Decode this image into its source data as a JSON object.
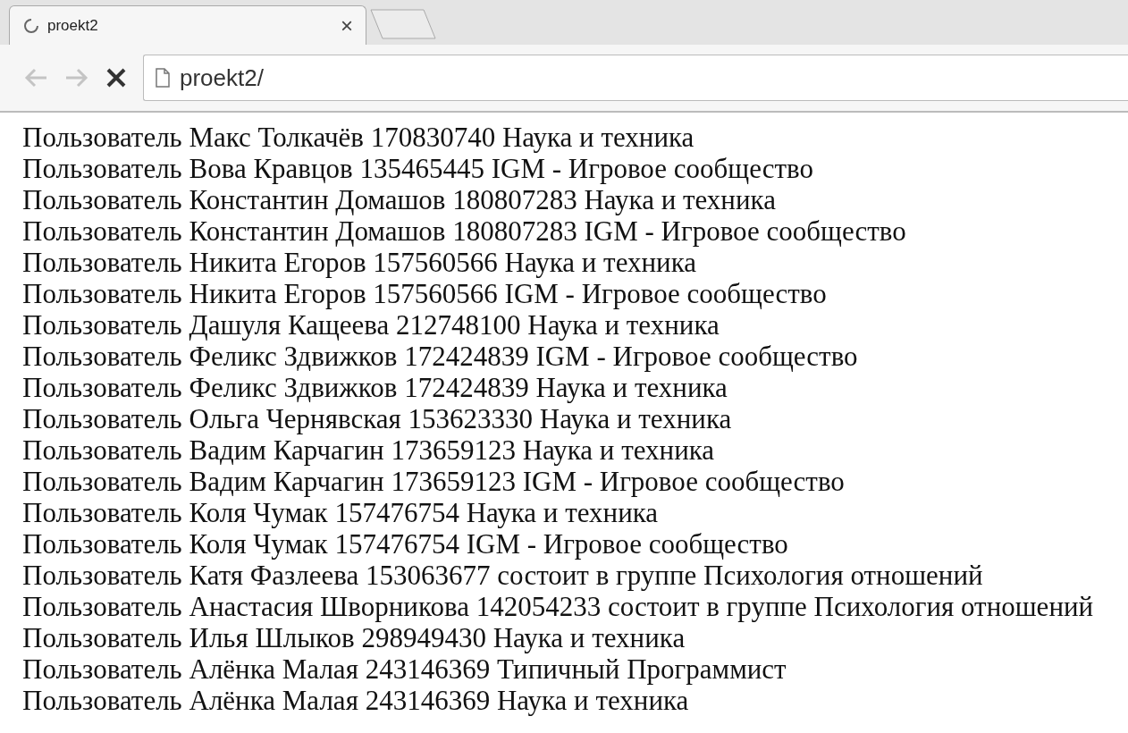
{
  "tab": {
    "title": "proekt2",
    "close": "×",
    "loading": true
  },
  "toolbar": {
    "address": "proekt2/",
    "back_disabled": true,
    "forward_disabled": true
  },
  "lines": [
    "Пользователь Макс Толкачёв 170830740 Наука и техника",
    "Пользователь Вова Кравцов 135465445 IGM - Игровое сообщество",
    "Пользователь Константин Домашов 180807283 Наука и техника",
    "Пользователь Константин Домашов 180807283 IGM - Игровое сообщество",
    "Пользователь Никита Егоров 157560566 Наука и техника",
    "Пользователь Никита Егоров 157560566 IGM - Игровое сообщество",
    "Пользователь Дашуля Кащеева 212748100 Наука и техника",
    "Пользователь Феликс Здвижков 172424839 IGM - Игровое сообщество",
    "Пользователь Феликс Здвижков 172424839 Наука и техника",
    "Пользователь Ольга Чернявская 153623330 Наука и техника",
    "Пользователь Вадим Карчагин 173659123 Наука и техника",
    "Пользователь Вадим Карчагин 173659123 IGM - Игровое сообщество",
    "Пользователь Коля Чумак 157476754 Наука и техника",
    "Пользователь Коля Чумак 157476754 IGM - Игровое сообщество",
    "Пользователь Катя Фазлеева 153063677 состоит в группе Психология отношений",
    "Пользователь Анастасия Шворникова 142054233 состоит в группе Психология отношений",
    "Пользователь Илья Шлыков 298949430 Наука и техника",
    "Пользователь Алёнка Малая 243146369 Типичный Программист",
    "Пользователь Алёнка Малая 243146369 Наука и техника"
  ]
}
